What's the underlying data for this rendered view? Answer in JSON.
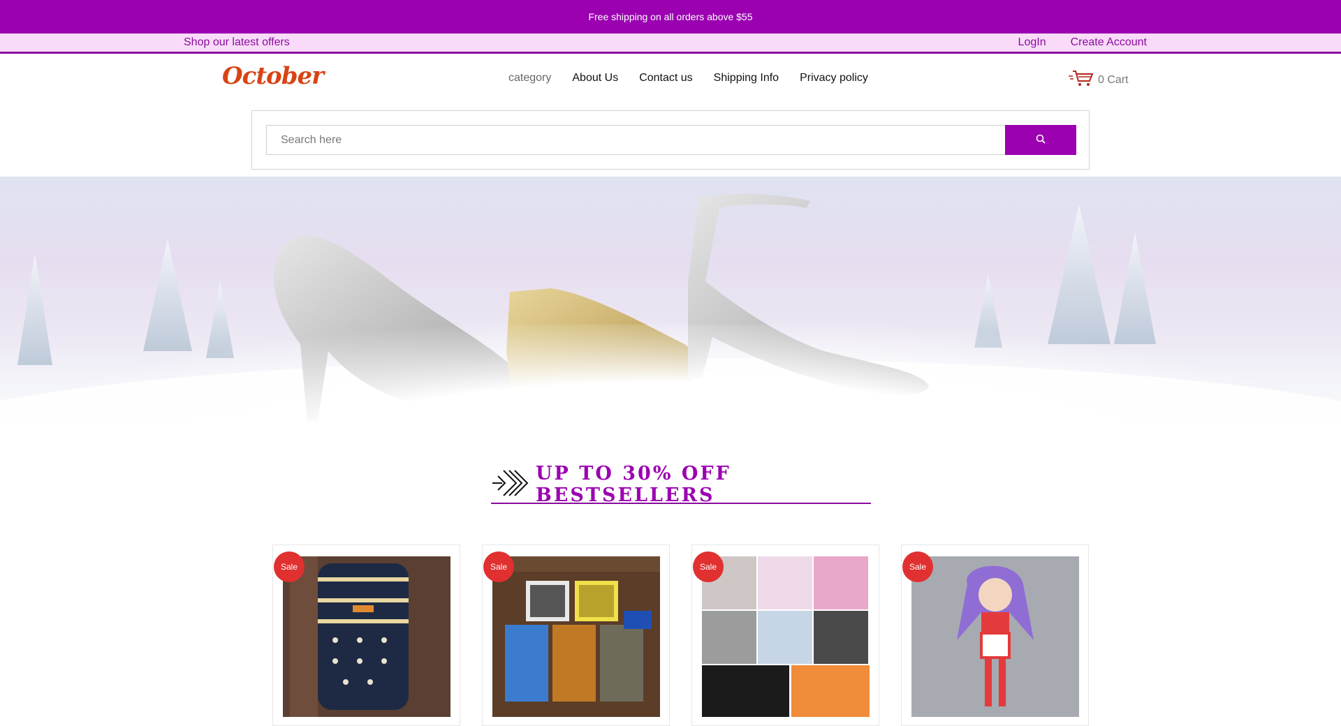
{
  "topbar": {
    "message": "Free shipping on all orders above $55"
  },
  "subbar": {
    "offers_link": "Shop our latest offers",
    "login": "LogIn",
    "create_account": "Create Account"
  },
  "header": {
    "logo": "October",
    "menu": [
      "category",
      "About Us",
      "Contact us",
      "Shipping Info",
      "Privacy policy"
    ],
    "cart_label": "0 Cart"
  },
  "search": {
    "placeholder": "Search here",
    "value": ""
  },
  "section": {
    "title": "UP TO 30% OFF BESTSELLERS"
  },
  "products": [
    {
      "badge": "Sale",
      "image": "striped backpack with anchor print"
    },
    {
      "badge": "Sale",
      "image": "video game cases"
    },
    {
      "badge": "Sale",
      "image": "fitness DVD covers"
    },
    {
      "badge": "Sale",
      "image": "anime figure"
    }
  ],
  "colors": {
    "brand": "#9b00b1",
    "subbar_bg": "#f9dbf9",
    "sale_badge": "#e03030",
    "logo": "#d84315"
  }
}
